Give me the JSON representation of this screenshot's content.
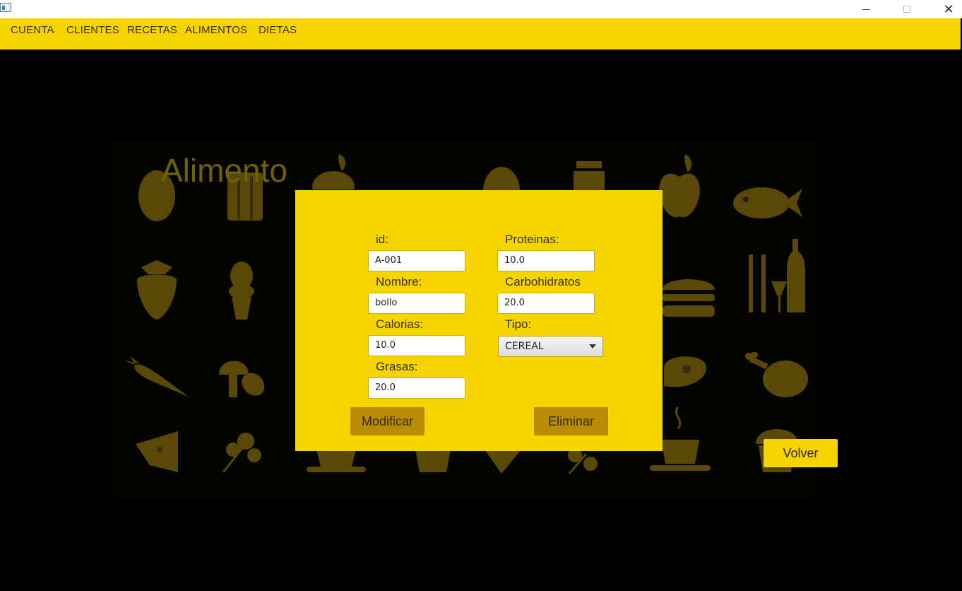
{
  "window": {
    "icons": {
      "app": "app-window-icon",
      "minimize": "minimize-icon",
      "maximize": "maximize-icon",
      "close": "close-icon"
    },
    "close_glyph": "✕"
  },
  "menu": {
    "items": [
      "CUENTA",
      "CLIENTES",
      "RECETAS",
      "ALIMENTOS",
      "DIETAS"
    ]
  },
  "background": {
    "icons": [
      "egg-icon",
      "bread-icon",
      "apple-icon",
      "milk-carton-icon",
      "apple-icon",
      "fish-icon",
      "strawberry-icon",
      "ice-cream-icon",
      "burger-icon",
      "cutlery-wine-icon",
      "carrot-icon",
      "mushroom-icon",
      "steak-icon",
      "chicken-leg-icon",
      "cheese-icon",
      "parsley-icon",
      "coffee-cup-icon",
      "muffin-icon"
    ]
  },
  "page": {
    "title": "Alimento"
  },
  "form": {
    "id": {
      "label": "id:",
      "value": "A-001"
    },
    "nombre": {
      "label": "Nombre:",
      "value": "bollo"
    },
    "calorias": {
      "label": "Calorias:",
      "value": "10.0"
    },
    "grasas": {
      "label": "Grasas:",
      "value": "20.0"
    },
    "proteinas": {
      "label": "Proteinas:",
      "value": "10.0"
    },
    "carbohidratos": {
      "label": "Carbohidratos",
      "value": "20.0"
    },
    "tipo": {
      "label": "Tipo:",
      "selected": "CEREAL"
    },
    "modificar_label": "Modificar",
    "eliminar_label": "Eliminar"
  },
  "volver_label": "Volver",
  "colors": {
    "accent": "#f5d400",
    "button": "#b98c06",
    "background": "#000000",
    "icon_tint": "#5a4808"
  }
}
